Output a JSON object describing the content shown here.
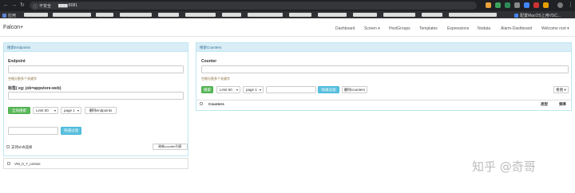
{
  "browser": {
    "security_label": "不安全",
    "url": "▆▆▆:8081",
    "nav_icons": [
      "back-icon",
      "forward-icon",
      "reload-icon"
    ],
    "bookmarks": [
      {
        "label": "应用",
        "color": "#5f86d6"
      },
      {
        "label": "配置MacOS上用VSC...",
        "color": "#4285f4"
      }
    ]
  },
  "navbar": {
    "brand": "Falcon+",
    "links": [
      {
        "label": "Dashboard"
      },
      {
        "label": "Screen ▾"
      },
      {
        "label": "HostGroups"
      },
      {
        "label": "Templates"
      },
      {
        "label": "Expressions"
      },
      {
        "label": "Nodata"
      },
      {
        "label": "Alarm-Dashboard"
      },
      {
        "label": "Welcome root ▾"
      }
    ]
  },
  "endpoints_panel": {
    "title": "搜索Endpoints",
    "endpoint_label": "Endpoint",
    "endpoint_hint": "空格分割多个关键字",
    "tag_label": "标签( eg: job=appstore-web)",
    "search_button": "全局搜索",
    "limit_select": "Limit 50",
    "page_select": "page 1",
    "delete_button": "删除endpoints",
    "filter_button": "快速过滤",
    "regex_label": "支持shift选择",
    "delete_counters_button": "刷新counter列表",
    "host_item": "VM_0_7_centos"
  },
  "counters_panel": {
    "title": "搜索Counters",
    "counter_label": "Counter",
    "counter_hint": "空格分割多个关键字",
    "search_button": "搜索",
    "limit_select": "Limit 50",
    "page_select": "page 1",
    "filter_button": "快速过滤",
    "delete_button": "删除counters",
    "view_button": "看图 ▾",
    "col_counters": "Counters",
    "col_type": "类型",
    "col_freq": "频率"
  },
  "watermark": "知乎 @奇哥"
}
